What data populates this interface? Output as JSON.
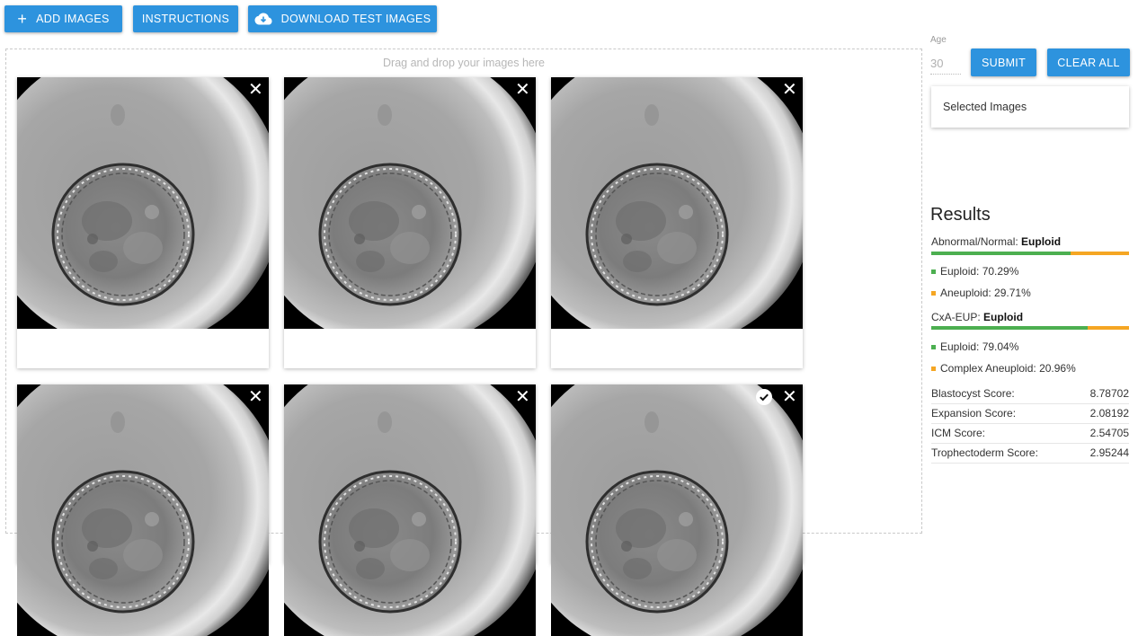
{
  "toolbar": {
    "add_label": "ADD IMAGES",
    "add_icon": "plus-icon",
    "instructions_label": "INSTRUCTIONS",
    "download_label": "DOWNLOAD TEST IMAGES",
    "download_icon": "cloud-download-icon",
    "accent": "#2d93de"
  },
  "dropzone": {
    "hint": "Drag and drop your images here"
  },
  "images": [
    {
      "selected": false
    },
    {
      "selected": false
    },
    {
      "selected": false
    },
    {
      "selected": false
    },
    {
      "selected": false
    },
    {
      "selected": true
    }
  ],
  "form": {
    "age_label": "Age",
    "age_value": "30",
    "submit_label": "SUBMIT",
    "clear_label": "CLEAR ALL",
    "selected_images_label": "Selected Images"
  },
  "results": {
    "title": "Results",
    "abnormal_normal": {
      "label": "Abnormal/Normal:",
      "verdict": "Euploid",
      "items": [
        {
          "label": "Euploid: 70.29%",
          "color": "#4caf50"
        },
        {
          "label": "Aneuploid: 29.71%",
          "color": "#f5a623"
        }
      ],
      "euploid_fraction": 0.7029
    },
    "cxa_eup": {
      "label": "CxA-EUP:",
      "verdict": "Euploid",
      "items": [
        {
          "label": "Euploid: 79.04%",
          "color": "#4caf50"
        },
        {
          "label": "Complex Aneuploid: 20.96%",
          "color": "#f5a623"
        }
      ],
      "euploid_fraction": 0.7904
    },
    "scores": [
      {
        "label": "Blastocyst Score:",
        "value": "8.78702"
      },
      {
        "label": "Expansion Score:",
        "value": "2.08192"
      },
      {
        "label": "ICM Score:",
        "value": "2.54705"
      },
      {
        "label": "Trophectoderm Score:",
        "value": "2.95244"
      }
    ]
  }
}
